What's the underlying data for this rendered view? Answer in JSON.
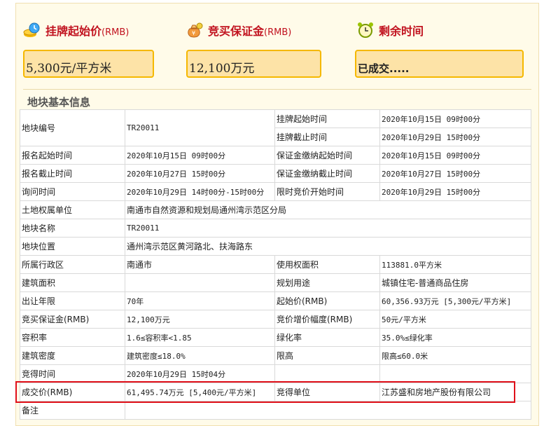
{
  "header": {
    "start_price": {
      "title": "挂牌起始价",
      "unit": "(RMB)",
      "value": "5,300元/平方米",
      "icon": "coins-clock-icon"
    },
    "deposit": {
      "title": "竞买保证金",
      "unit": "(RMB)",
      "value": "12,100万元",
      "icon": "money-bag-icon"
    },
    "remaining": {
      "title": "剩余时间",
      "value": "已成交.....",
      "icon": "alarm-clock-icon"
    }
  },
  "section_title": "地块基本信息",
  "table": {
    "plot_no_label": "地块编号",
    "plot_no": "TR20011",
    "list_start_label": "挂牌起始时间",
    "list_start": "2020年10月15日 09时00分",
    "list_end_label": "挂牌截止时间",
    "list_end": "2020年10月29日 15时00分",
    "reg_start_label": "报名起始时间",
    "reg_start": "2020年10月15日 09时00分",
    "dep_start_label": "保证金缴纳起始时间",
    "dep_start": "2020年10月15日 09时00分",
    "reg_end_label": "报名截止时间",
    "reg_end": "2020年10月27日 15时00分",
    "dep_end_label": "保证金缴纳截止时间",
    "dep_end": "2020年10月27日 15时00分",
    "inquiry_label": "询问时间",
    "inquiry": "2020年10月29日 14时00分-15时00分",
    "limit_start_label": "限时竞价开始时间",
    "limit_start": "2020年10月29日 15时00分",
    "owner_label": "土地权属单位",
    "owner": "南通市自然资源和规划局通州湾示范区分局",
    "name_label": "地块名称",
    "name": "TR20011",
    "location_label": "地块位置",
    "location": "通州湾示范区黄河路北、扶海路东",
    "district_label": "所属行政区",
    "district": "南通市",
    "use_area_label": "使用权面积",
    "use_area": "113881.0平方米",
    "build_area_label": "建筑面积",
    "build_area": "",
    "plan_use_label": "规划用途",
    "plan_use": "城镇住宅-普通商品住房",
    "term_label": "出让年限",
    "term": "70年",
    "start_price_label": "起始价(RMB)",
    "start_price": "60,356.93万元 [5,300元/平方米]",
    "deposit_label": "竞买保证金(RMB)",
    "deposit": "12,100万元",
    "increment_label": "竞价增价幅度(RMB)",
    "increment": "50元/平方米",
    "far_label": "容积率",
    "far": "1.6≤容积率<1.85",
    "green_label": "绿化率",
    "green": "35.0%≤绿化率",
    "density_label": "建筑密度",
    "density": "建筑密度≤18.0%",
    "height_label": "限高",
    "height": "限高≤60.0米",
    "win_time_label": "竞得时间",
    "win_time": "2020年10月29日 15时04分",
    "deal_price_label": "成交价(RMB)",
    "deal_price": "61,495.74万元 [5,400元/平方米]",
    "winner_label": "竞得单位",
    "winner": "江苏盛和房地产股份有限公司",
    "remark_label": "备注",
    "remark": ""
  },
  "colors": {
    "title_red": "#c1121f",
    "box_fill": "#fde3a7",
    "box_border": "#f5b800",
    "highlight": "#e0101a",
    "panel_bg": "#fffbe9"
  }
}
